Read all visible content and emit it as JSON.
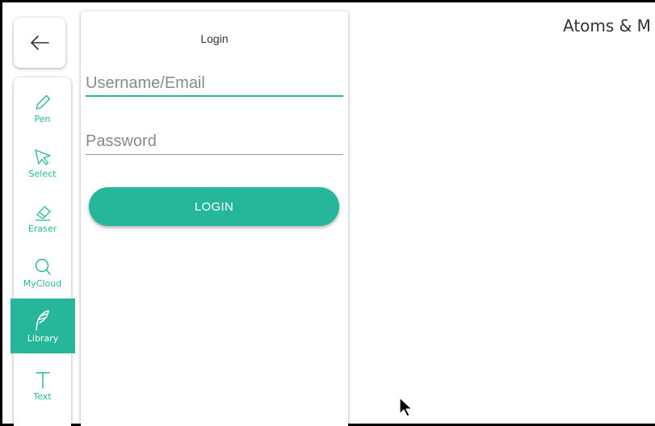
{
  "document": {
    "title": "Atoms & M"
  },
  "back": {
    "icon": "arrow-left-icon"
  },
  "toolbar": {
    "accent": "#26b79a",
    "items": [
      {
        "label": "Pen",
        "icon": "pen-icon",
        "active": false
      },
      {
        "label": "Select",
        "icon": "cursor-pointer-icon",
        "active": false
      },
      {
        "label": "Eraser",
        "icon": "eraser-icon",
        "active": false
      },
      {
        "label": "MyCloud",
        "icon": "search-icon",
        "active": false
      },
      {
        "label": "Library",
        "icon": "quill-icon",
        "active": true
      },
      {
        "label": "Text",
        "icon": "text-icon",
        "active": false
      }
    ]
  },
  "login": {
    "title": "Login",
    "username_placeholder": "Username/Email",
    "username_value": "",
    "password_placeholder": "Password",
    "password_value": "",
    "button_label": "LOGIN"
  }
}
